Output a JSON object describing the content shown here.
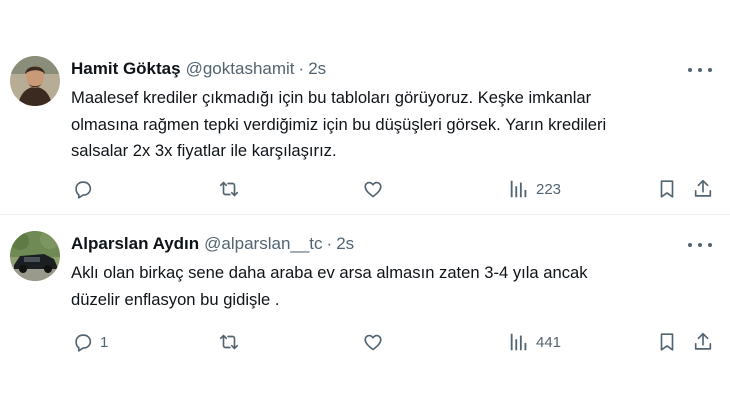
{
  "tweets": [
    {
      "name": "Hamit Göktaş",
      "handle": "@goktashamit",
      "separator": "·",
      "time": "2s",
      "lines": [
        "Maalesef krediler çıkmadığı için bu tabloları görüyoruz. Keşke imkanlar",
        "olmasına rağmen tepki verdiğimiz için bu düşüşleri görsek. Yarın kredileri",
        "salsalar 2x 3x fiyatlar ile karşılaşırız."
      ],
      "reply_count": "",
      "retweet_count": "",
      "like_count": "",
      "views": "223"
    },
    {
      "name": "Alparslan Aydın",
      "handle": "@alparslan__tc",
      "separator": "·",
      "time": "2s",
      "lines": [
        "Aklı olan birkaç sene daha araba ev arsa almasın zaten 3-4 yıla ancak",
        "düzelir enflasyon bu gidişle ."
      ],
      "reply_count": "1",
      "retweet_count": "",
      "like_count": "",
      "views": "441"
    }
  ],
  "colors": {
    "text": "#0f1419",
    "secondary": "#536471",
    "divider": "#eff3f4"
  },
  "icons": {
    "reply": "reply-icon",
    "retweet": "retweet-icon",
    "like": "heart-icon",
    "views": "views-icon",
    "bookmark": "bookmark-icon",
    "share": "share-icon",
    "more": "more-icon"
  }
}
